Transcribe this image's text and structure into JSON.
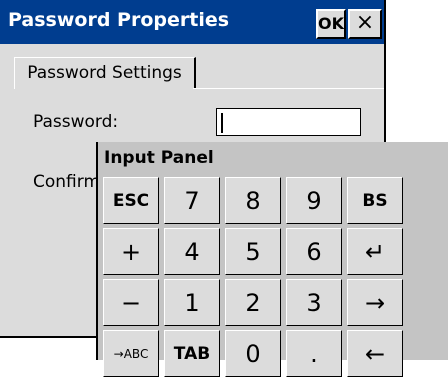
{
  "dialog": {
    "title": "Password Properties",
    "ok_label": "OK",
    "close_label": "×",
    "tab_label": "Password Settings",
    "password_label": "Password:",
    "password_value": "",
    "confirm_label": "Confirm"
  },
  "input_panel": {
    "title": "Input Panel",
    "rows": [
      [
        "ESC",
        "7",
        "8",
        "9",
        "BS"
      ],
      [
        "+",
        "4",
        "5",
        "6",
        "↵"
      ],
      [
        "−",
        "1",
        "2",
        "3",
        "→"
      ],
      [
        "→ABC",
        "TAB",
        "0",
        ".",
        "←"
      ]
    ]
  }
}
